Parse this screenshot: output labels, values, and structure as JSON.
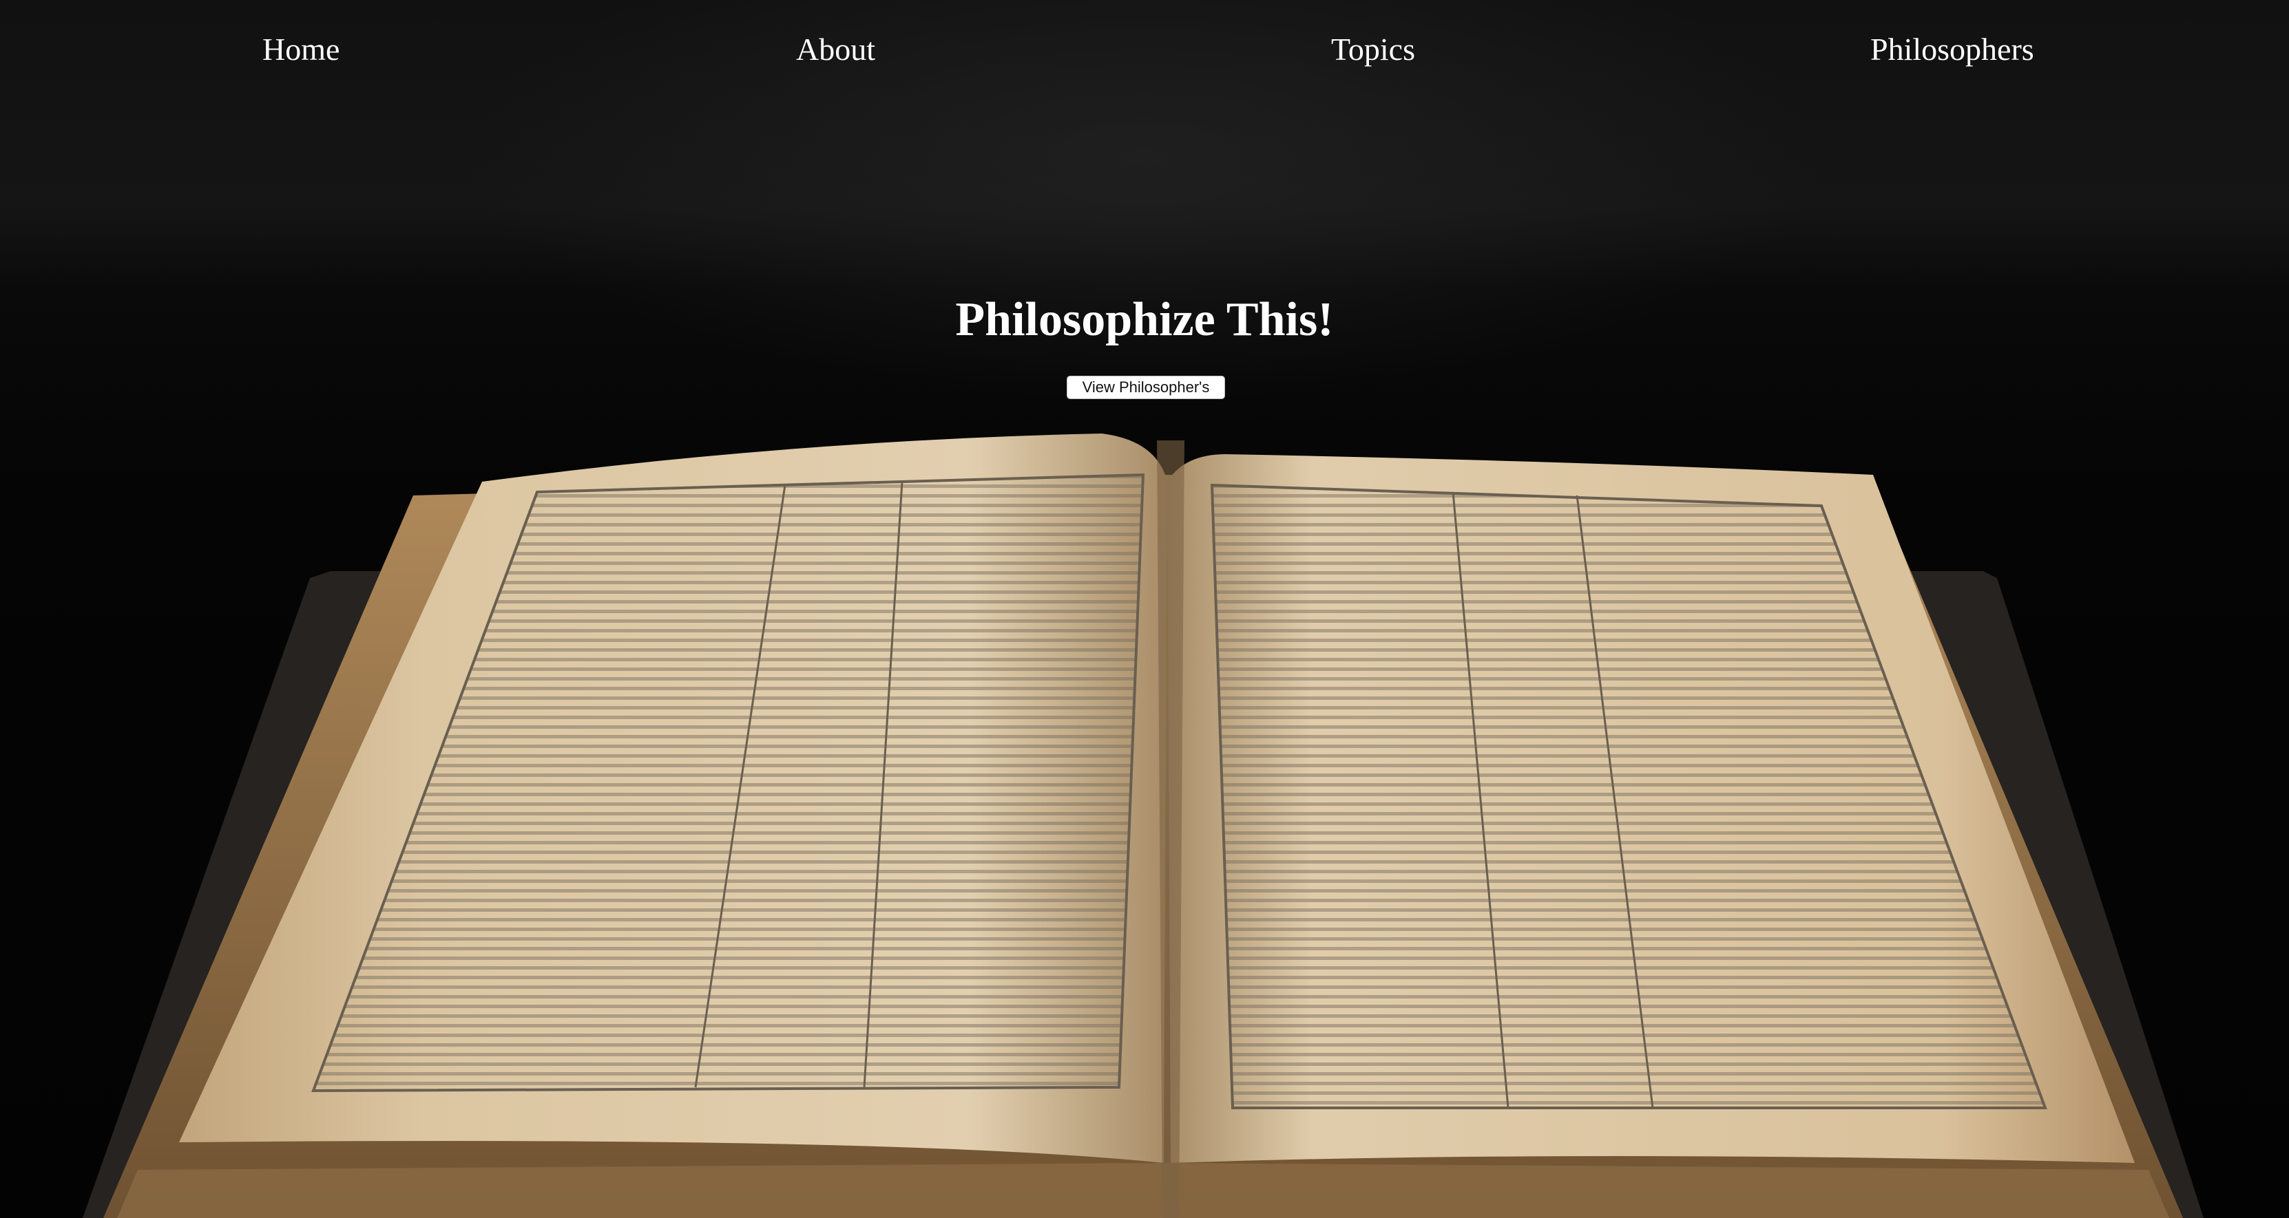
{
  "nav": {
    "items": [
      {
        "label": "Home"
      },
      {
        "label": "About"
      },
      {
        "label": "Topics"
      },
      {
        "label": "Philosophers"
      }
    ]
  },
  "hero": {
    "title": "Philosophize This!",
    "button_label": "View Philosopher's",
    "background_image": "open-antique-book"
  },
  "colors": {
    "background": "#050505",
    "text": "#ffffff",
    "paper": "#d8c4a2",
    "paper_edge": "#8c6a3e",
    "button_bg": "#ffffff",
    "button_text": "#111111"
  }
}
